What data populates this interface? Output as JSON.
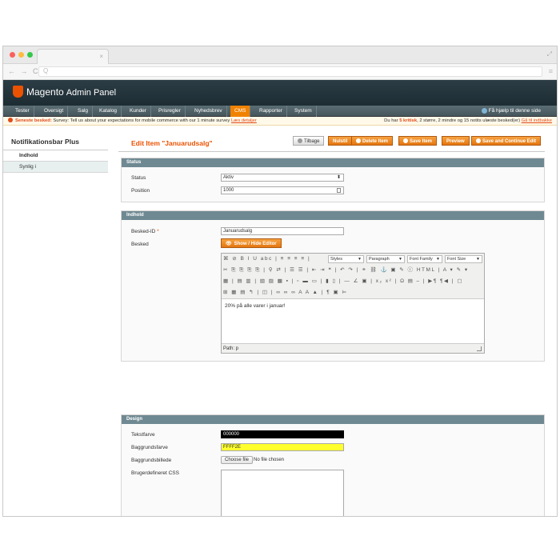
{
  "window": {
    "tab_close": "×",
    "url_placeholder": "Q"
  },
  "header": {
    "brand": "Magento",
    "brand_suffix": "Admin Panel"
  },
  "nav": {
    "items": [
      "Tester",
      "Oversigt",
      "Salg",
      "Katalog",
      "Kunder",
      "Prisregler",
      "Nyhedsbrev",
      "CMS",
      "Rapporter",
      "System"
    ],
    "active": "CMS",
    "help": "Få hjælp til denne side"
  },
  "notice": {
    "latest_label": "Seneste besked:",
    "message": "Survey: Tell us about your expectations for mobile commerce with our 1 minute survey",
    "link": "Læs detaljer",
    "summary_prefix": "Du har",
    "critical_count": "5 kritisk",
    "rest": ", 2 større, 2 mindre og 15 notits ulæste besked(er)",
    "inbox_link": "Gå til indbakke"
  },
  "sidebar": {
    "title": "Notifikationsbar Plus",
    "items": [
      "Indhold",
      "Synlig i"
    ]
  },
  "page": {
    "title": "Edit Item \"Januarudsalg\"",
    "buttons": {
      "back": "Tilbage",
      "reset": "Nulstil",
      "delete": "Delete Item",
      "save": "Save Item",
      "preview": "Preview",
      "save_continue": "Save and Continue Edit"
    }
  },
  "status_section": {
    "heading": "Status",
    "status_label": "Status",
    "status_value": "Aktiv",
    "position_label": "Position",
    "position_value": "1000"
  },
  "content_section": {
    "heading": "Indhold",
    "id_label": "Besked-ID",
    "required_mark": "*",
    "id_value": "Januarudsalg",
    "message_label": "Besked",
    "toggle_editor": "Show / Hide Editor",
    "toolbar": {
      "row1": "⌘ ⊘  B  I  U  abc | ≡  ≡  ≡  ≡ |",
      "styles": "Styles",
      "paragraph": "Paragraph",
      "font_family": "Font Family",
      "font_size": "Font Size",
      "row2": "✂ ⎘ ⎘ ⎘ ⎘ | ⚲ ⇄ | ☰ ☰ | ⇤ ⇥ ❝ | ↶ ↷ | ⚭ ⛓ ⚓ ▣ ✎ ⓘ HTML | A ▾ ✎ ▾",
      "row3": "▦ | ▤ ▥ | ▧ ▨ ▩ ▪ | ▫ ▬ ▭ | ▮ ▯ | — ∠ ▣ | x₂ x² | Ω ▤ ⎯ | ▶¶ ¶◀ | ▢",
      "row4": "⊞ ▦ ▤ ↰ | ◫ | ∞ ∞ ∞ A A ▲ | ¶ ▣ ⊨"
    },
    "editor_text": "20% på alle varer i januar!",
    "path": "Path: p"
  },
  "design_section": {
    "heading": "Design",
    "text_color_label": "Tekstfarve",
    "text_color_value": "000000",
    "bg_color_label": "Baggrundsfarve",
    "bg_color_value": "FFFF2E",
    "bg_image_label": "Baggrundsbillede",
    "choose_file": "Choose file",
    "no_file": "No file chosen",
    "custom_css_label": "Brugerdefineret CSS"
  },
  "colors": {
    "accent": "#eb5202",
    "nav_active": "#f18200",
    "header": "#2c3d45",
    "section_head": "#6f8992"
  },
  "icons": [
    "search-icon",
    "help-icon",
    "warning-icon",
    "back-icon",
    "delete-icon",
    "save-icon",
    "eye-icon"
  ]
}
